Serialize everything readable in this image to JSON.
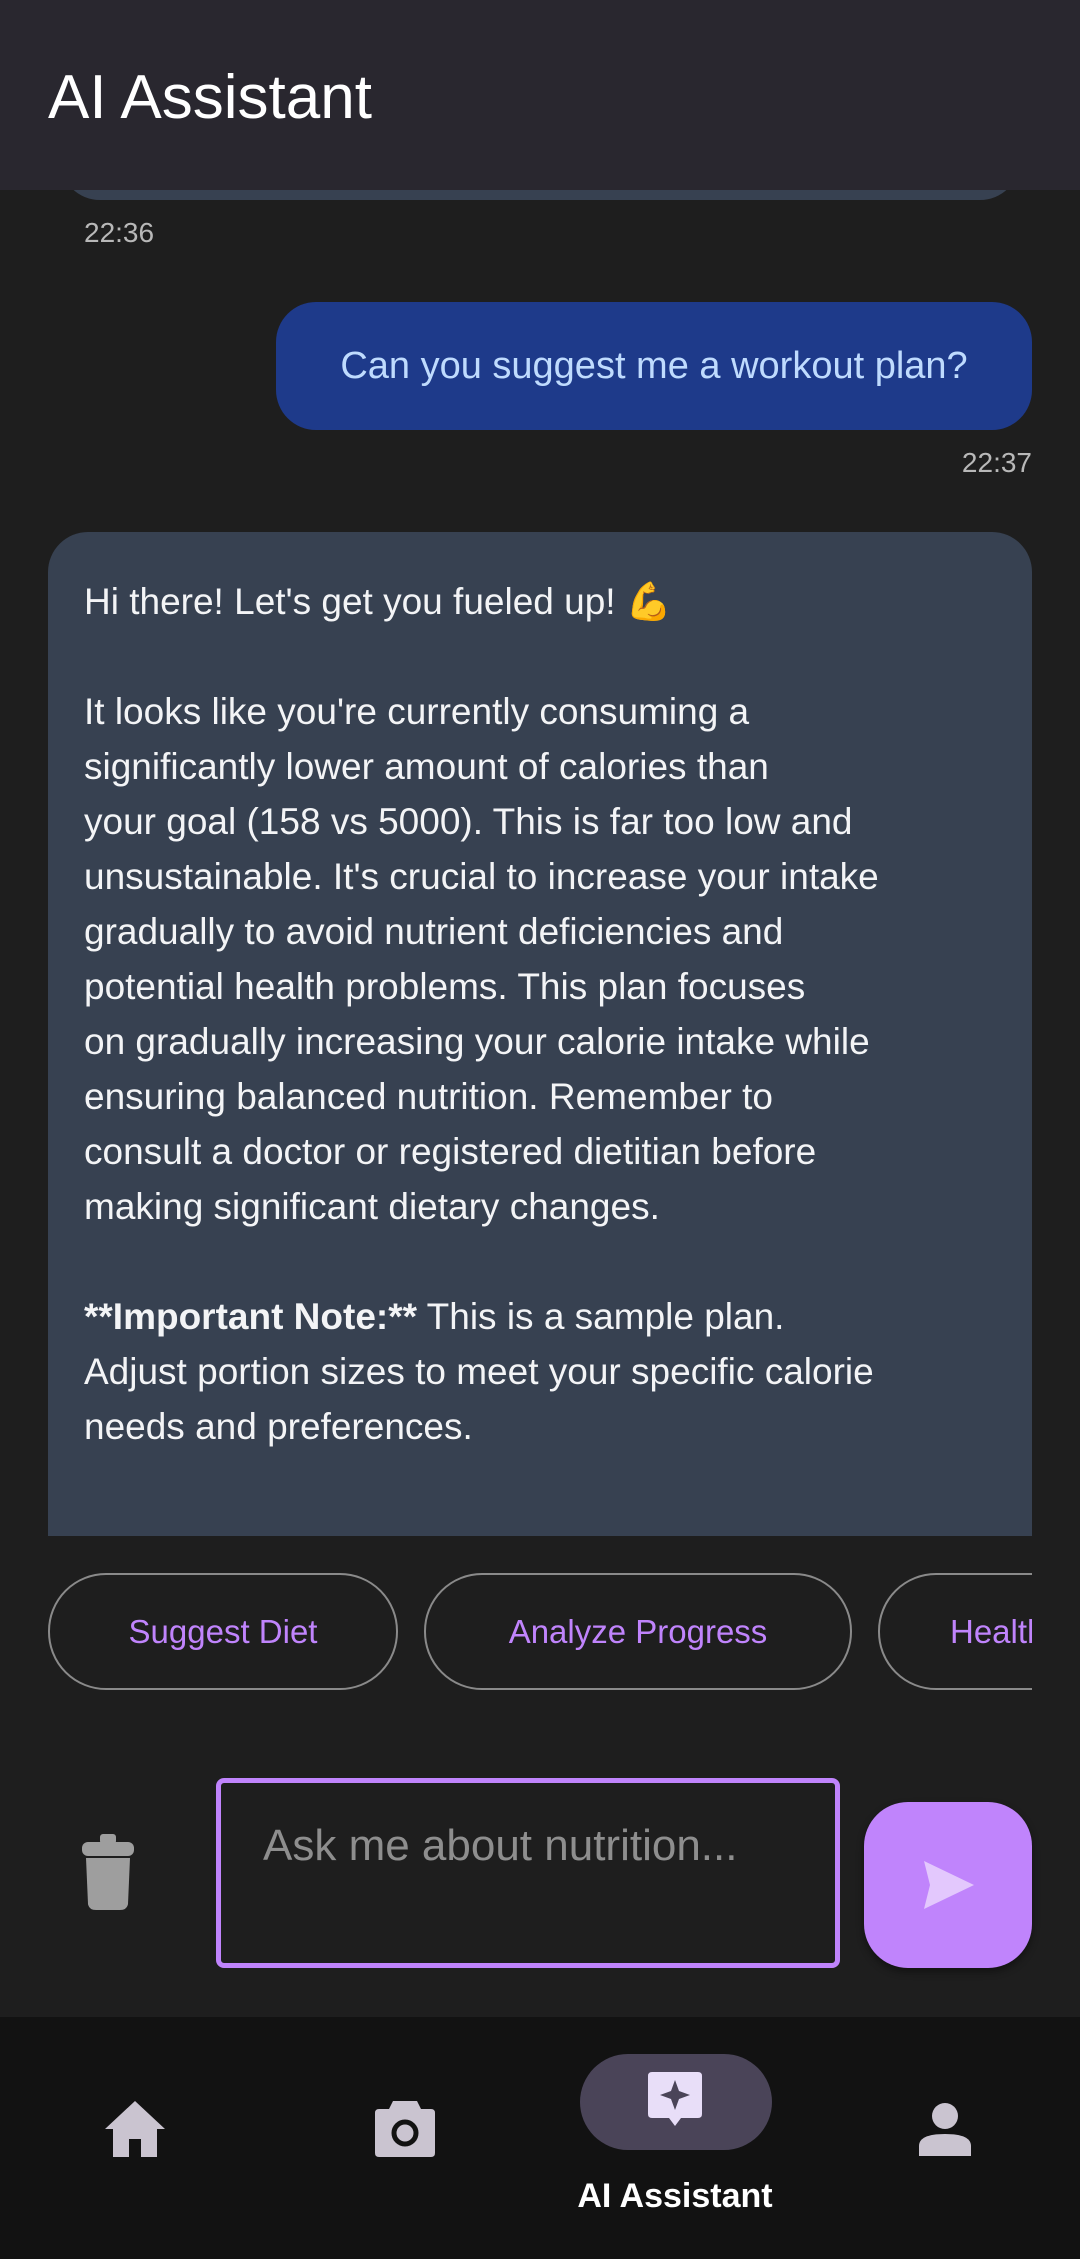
{
  "header": {
    "title": "AI Assistant"
  },
  "messages": [
    {
      "role": "assistant",
      "time": "22:36"
    },
    {
      "role": "user",
      "text": "Can you suggest me a workout plan?",
      "time": "22:37"
    },
    {
      "role": "assistant",
      "lines": [
        "Hi there!  Let's get you fueled up! 💪",
        "",
        "It looks like you're currently consuming a",
        "significantly lower amount of calories than",
        "your goal (158 vs 5000). This is far too low and",
        "unsustainable.  It's crucial to increase your intake",
        "gradually to avoid nutrient deficiencies and",
        "potential health problems.  This plan focuses",
        "on gradually increasing your calorie intake while",
        "ensuring balanced nutrition. Remember to",
        "consult a doctor or registered dietitian before",
        "making significant dietary changes.",
        "",
        "",
        "Adjust portion sizes to meet your specific calorie",
        "needs and preferences."
      ],
      "note_bold": "**Important Note:**",
      "note_rest": " This is a sample plan."
    }
  ],
  "chips": [
    "Suggest Diet",
    "Analyze Progress",
    "Health"
  ],
  "input": {
    "placeholder": "Ask me about nutrition..."
  },
  "nav": {
    "items": [
      {
        "icon": "home-icon",
        "label": ""
      },
      {
        "icon": "camera-icon",
        "label": ""
      },
      {
        "icon": "ai-assistant-icon",
        "label": "AI Assistant",
        "active": true
      },
      {
        "icon": "profile-icon",
        "label": ""
      }
    ]
  },
  "colors": {
    "accent": "#c084fc",
    "user_bubble": "#1e3a8a",
    "ai_bubble": "#374151",
    "header": "#29272f"
  }
}
